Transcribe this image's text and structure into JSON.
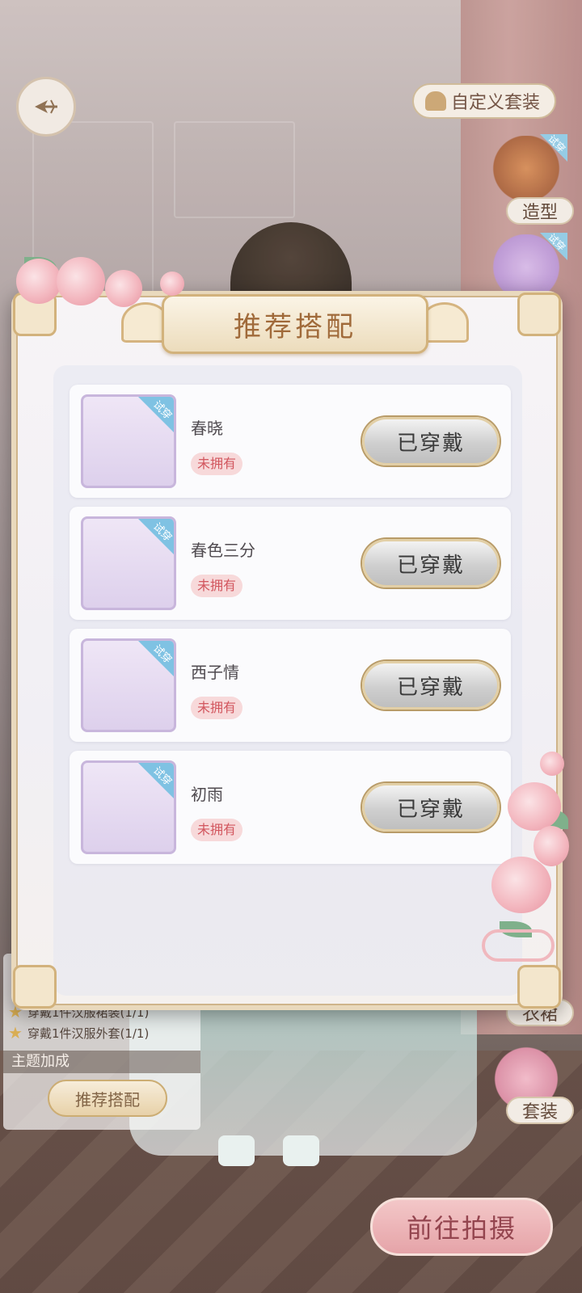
{
  "header": {
    "back_icon": "back-arrow-icon",
    "custom_outfit_label": "自定义套装"
  },
  "side_menu": {
    "styling_label": "造型",
    "outfit_label": "套装",
    "try_on_tag": "试穿",
    "partial_label": "衣裙"
  },
  "bonus_panel": {
    "rows": [
      "穿戴1件汉服裙装(1/1)",
      "穿戴1件汉服外套(1/1)"
    ],
    "theme_bonus_label": "主题加成",
    "recommend_button_label": "推荐搭配"
  },
  "shoot_button_label": "前往拍摄",
  "modal": {
    "title": "推荐搭配",
    "items": [
      {
        "name": "春晓",
        "status": "未拥有",
        "button": "已穿戴",
        "tag": "试穿"
      },
      {
        "name": "春色三分",
        "status": "未拥有",
        "button": "已穿戴",
        "tag": "试穿"
      },
      {
        "name": "西子情",
        "status": "未拥有",
        "button": "已穿戴",
        "tag": "试穿"
      },
      {
        "name": "初雨",
        "status": "未拥有",
        "button": "已穿戴",
        "tag": "试穿"
      }
    ]
  },
  "colors": {
    "accent_gold": "#d2b27c",
    "badge_pink": "#d2565e",
    "tag_blue": "#7fc2e3"
  }
}
